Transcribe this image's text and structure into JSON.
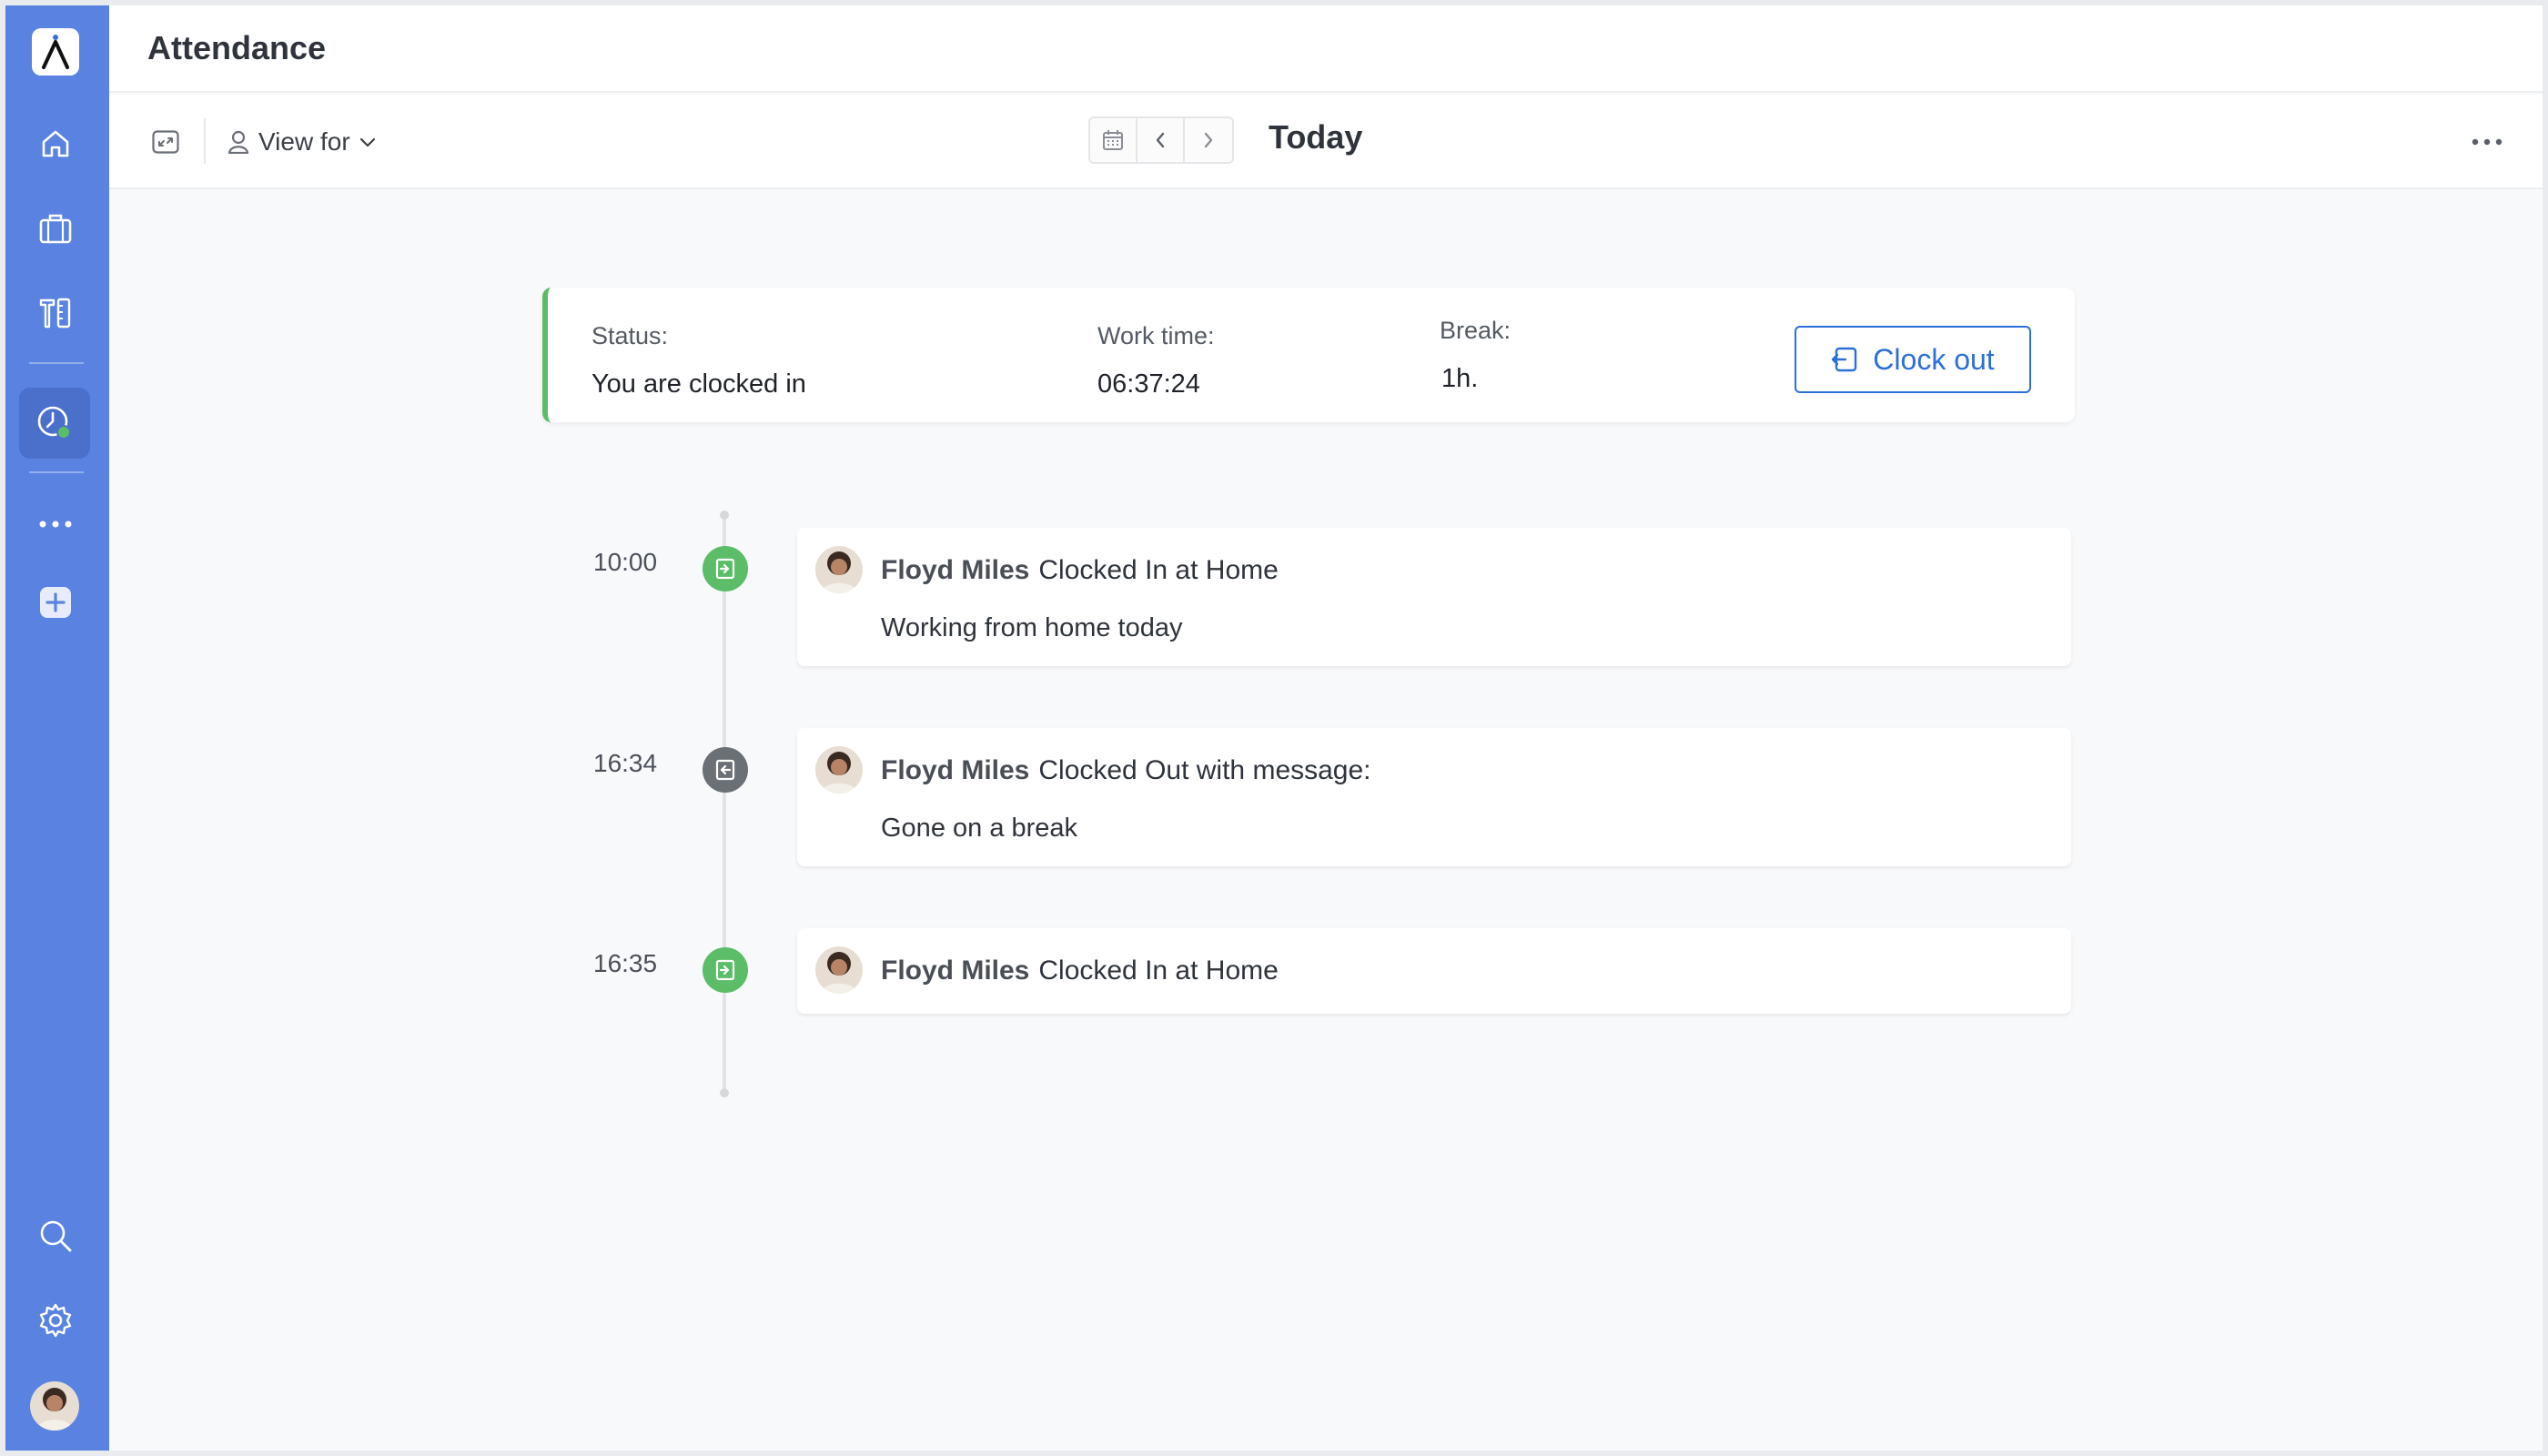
{
  "app": {
    "title": "Attendance"
  },
  "toolbar": {
    "view_for_label": "View for",
    "date_label": "Today"
  },
  "status": {
    "status_label": "Status:",
    "status_value": "You are clocked in",
    "worktime_label": "Work time:",
    "worktime_value": "06:37:24",
    "break_label": "Break:",
    "break_value": "1h.",
    "clockout_label": "Clock out"
  },
  "timeline": [
    {
      "time": "10:00",
      "type": "in",
      "person": "Floyd Miles",
      "action": "Clocked In at Home",
      "message": "Working from home today"
    },
    {
      "time": "16:34",
      "type": "out",
      "person": "Floyd Miles",
      "action": "Clocked Out with message:",
      "message": "Gone on a break"
    },
    {
      "time": "16:35",
      "type": "in",
      "person": "Floyd Miles",
      "action": "Clocked In at Home",
      "message": ""
    }
  ],
  "colors": {
    "sidebar": "#5a83e1",
    "accent": "#2d6fd9",
    "clock_in": "#5bbd67",
    "clock_out": "#6b6f76"
  },
  "icons": {
    "sidebar_top": [
      "home-icon",
      "briefcase-icon",
      "tools-icon",
      "attendance-clock-icon",
      "more-dots-icon",
      "add-icon"
    ],
    "sidebar_bottom": [
      "search-icon",
      "gear-icon"
    ]
  }
}
